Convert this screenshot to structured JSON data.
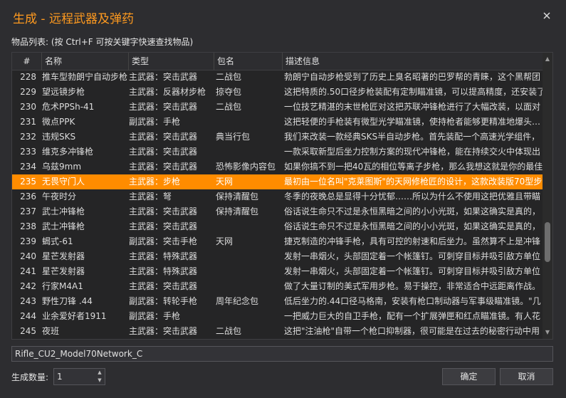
{
  "window": {
    "title": "生成 - 远程武器及弹药",
    "close_icon": "close-icon"
  },
  "list_caption": "物品列表: (按 Ctrl+F 可按关键字快速查找物品)",
  "columns": [
    "#",
    "名称",
    "类型",
    "包名",
    "描述信息"
  ],
  "rows": [
    {
      "num": "228",
      "name": "推车型勃朗宁自动步枪",
      "type": "主武器：突击武器",
      "pkg": "二战包",
      "desc": "勃朗宁自动步枪受到了历史上臭名昭著的巴罗帮的青睐，这个黑帮团"
    },
    {
      "num": "229",
      "name": "望远镜步枪",
      "type": "主武器：反器材步枪",
      "pkg": "掠夺包",
      "desc": "这把特质的.50口径步枪装配有定制瞄准镜，可以提高精度，还安装了"
    },
    {
      "num": "230",
      "name": "危术PPSh-41",
      "type": "主武器：突击武器",
      "pkg": "二战包",
      "desc": "一位技艺精湛的末世枪匠对这把苏联冲锋枪进行了大幅改装，以面对"
    },
    {
      "num": "231",
      "name": "微点PPK",
      "type": "副武器：手枪",
      "pkg": "",
      "desc": "这把轻便的手枪装有微型光学瞄准镜，使持枪者能够更精准地爆头…"
    },
    {
      "num": "232",
      "name": "违规SKS",
      "type": "主武器：突击武器",
      "pkg": "典当行包",
      "desc": "我们来改装一款经典SKS半自动步枪。首先装配一个高速光学组件，"
    },
    {
      "num": "233",
      "name": "维克多冲锋枪",
      "type": "主武器：突击武器",
      "pkg": "",
      "desc": "一款采取新型后坐力控制方案的现代冲锋枪，能在持续交火中体现出"
    },
    {
      "num": "234",
      "name": "乌兹9mm",
      "type": "主武器：突击武器",
      "pkg": "恐怖影像内容包",
      "desc": "如果你搞不到一把40瓦的相位等离子步枪，那么我想这就是你的最佳"
    },
    {
      "num": "235",
      "name": "无畏守门人",
      "type": "主武器：步枪",
      "pkg": "天网",
      "desc": "最初由一位名叫\"克莱图斯\"的天网修枪匠的设计，这款改装版70型步"
    },
    {
      "num": "236",
      "name": "午夜时分",
      "type": "主武器：弩",
      "pkg": "保持清醒包",
      "desc": "冬季的夜晚总是显得十分忧郁……所以为什么不使用这把优雅且带瞄"
    },
    {
      "num": "237",
      "name": "武士冲锋枪",
      "type": "主武器：突击武器",
      "pkg": "保持清醒包",
      "desc": "俗话说生命只不过是永恒黑暗之间的小小光斑，如果这确实是真的，"
    },
    {
      "num": "238",
      "name": "武士冲锋枪",
      "type": "主武器：突击武器",
      "pkg": "",
      "desc": "俗话说生命只不过是永恒黑暗之间的小小光斑，如果这确实是真的，"
    },
    {
      "num": "239",
      "name": "蝎式-61",
      "type": "副武器：突击手枪",
      "pkg": "天网",
      "desc": "捷克制造的冲锋手枪，具有可控的射速和后坐力。虽然算不上是冲锋"
    },
    {
      "num": "240",
      "name": "星芒发射器",
      "type": "主武器：特殊武器",
      "pkg": "",
      "desc": "发射一串烟火，头部固定着一个帐篷钉。可刺穿目标并吸引敌方单位"
    },
    {
      "num": "241",
      "name": "星芒发射器",
      "type": "主武器：特殊武器",
      "pkg": "",
      "desc": "发射一串烟火，头部固定着一个帐篷钉。可刺穿目标并吸引敌方单位"
    },
    {
      "num": "242",
      "name": "行家M4A1",
      "type": "主武器：突击武器",
      "pkg": "",
      "desc": "做了大量订制的美式军用步枪。易于操控，非常适合中远距离作战。"
    },
    {
      "num": "243",
      "name": "野性刀锋 .44",
      "type": "副武器：转轮手枪",
      "pkg": "周年纪念包",
      "desc": "低后坐力的.44口径马格南，安装有枪口制动器与军事级瞄准镜。\"几"
    },
    {
      "num": "244",
      "name": "业余爱好者1911",
      "type": "副武器：手枪",
      "pkg": "",
      "desc": "一把威力巨大的自卫手枪，配有一个扩展弹匣和红点瞄准镜。有人花"
    },
    {
      "num": "245",
      "name": "夜班",
      "type": "主武器：突击武器",
      "pkg": "二战包",
      "desc": "这把\"注油枪\"自带一个枪口抑制器，很可能是在过去的秘密行动中用"
    }
  ],
  "selected_row": "235",
  "id_field": {
    "value": "Rifle_CU2_Model70Network_C"
  },
  "quantity": {
    "label": "生成数量:",
    "value": "1"
  },
  "buttons": {
    "ok": "确定",
    "cancel": "取消"
  },
  "colors": {
    "accent": "#ff8c00",
    "title": "#ff9a1f",
    "background": "#2d2d30"
  }
}
